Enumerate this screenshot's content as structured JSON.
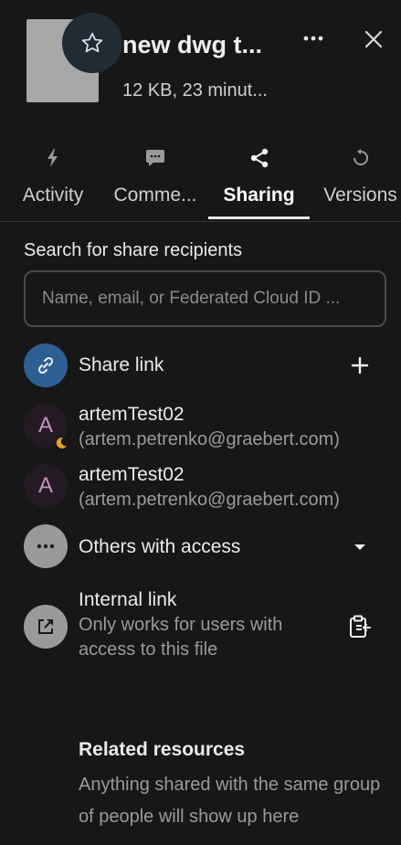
{
  "header": {
    "title": "new dwg t...",
    "subtitle": "12 KB, 23 minut...",
    "icons": {
      "favorite": "star-outline-icon",
      "menu": "dots-horizontal-icon",
      "close": "close-icon"
    }
  },
  "tabs": [
    {
      "label": "Activity",
      "icon": "lightning-icon"
    },
    {
      "label": "Comme...",
      "icon": "comment-icon"
    },
    {
      "label": "Sharing",
      "icon": "share-icon",
      "active": true
    },
    {
      "label": "Versions",
      "icon": "history-icon"
    }
  ],
  "search": {
    "label": "Search for share recipients",
    "placeholder": "Name, email, or Federated Cloud ID ..."
  },
  "share_link": {
    "label": "Share link",
    "icon": "link-icon",
    "action_icon": "plus-icon"
  },
  "shares": [
    {
      "initial": "A",
      "name": "artemTest02",
      "email": "(artem.petrenko@graebert.com)",
      "status_icon": "moon-icon"
    },
    {
      "initial": "A",
      "name": "artemTest02",
      "email": "(artem.petrenko@graebert.com)"
    }
  ],
  "others": {
    "label": "Others with access",
    "icon": "dots-horizontal-icon",
    "action_icon": "caret-down-icon"
  },
  "internal_link": {
    "title": "Internal link",
    "description_line1": "Only works for users with",
    "description_line2": "access to this file",
    "icon": "open-in-new-icon",
    "action_icon": "clipboard-copy-icon"
  },
  "related": {
    "title": "Related resources",
    "description": "Anything shared with the same group of people will show up here"
  },
  "colors": {
    "background": "#171717",
    "link_circle": "#2e5f94",
    "avatar_bg": "#241a24",
    "avatar_text": "#c88fc0",
    "neutral_circle": "#9a9a9a"
  }
}
